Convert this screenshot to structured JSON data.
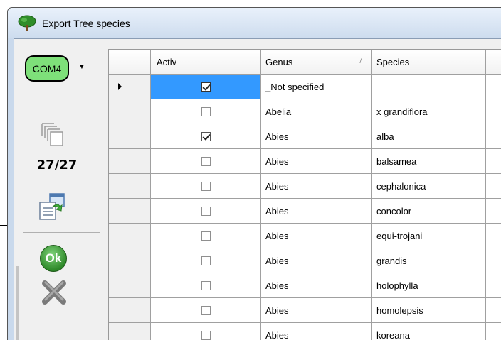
{
  "window": {
    "title": "Export Tree species"
  },
  "sidebar": {
    "port_label": "COM4",
    "counter": "27/27",
    "ok_label": "Ok"
  },
  "grid": {
    "columns": [
      "Activ",
      "Genus",
      "Species"
    ],
    "rows": [
      {
        "activ": true,
        "genus": "_Not specified",
        "species": "",
        "current": true
      },
      {
        "activ": false,
        "genus": "Abelia",
        "species": "x grandiflora"
      },
      {
        "activ": true,
        "genus": "Abies",
        "species": "alba"
      },
      {
        "activ": false,
        "genus": "Abies",
        "species": "balsamea"
      },
      {
        "activ": false,
        "genus": "Abies",
        "species": "cephalonica"
      },
      {
        "activ": false,
        "genus": "Abies",
        "species": "concolor"
      },
      {
        "activ": false,
        "genus": "Abies",
        "species": "equi-trojani"
      },
      {
        "activ": false,
        "genus": "Abies",
        "species": "grandis"
      },
      {
        "activ": false,
        "genus": "Abies",
        "species": "holophylla"
      },
      {
        "activ": false,
        "genus": "Abies",
        "species": "homolepsis"
      },
      {
        "activ": false,
        "genus": "Abies",
        "species": "koreana"
      }
    ]
  },
  "icons": {
    "app": "tree-icon",
    "layers": "layers-icon",
    "export": "export-icon",
    "ok": "ok-icon",
    "cancel": "close-icon"
  },
  "colors": {
    "com_button": "#7ee07a",
    "selection": "#3399ff",
    "ok_button": "#2f8a2a"
  }
}
